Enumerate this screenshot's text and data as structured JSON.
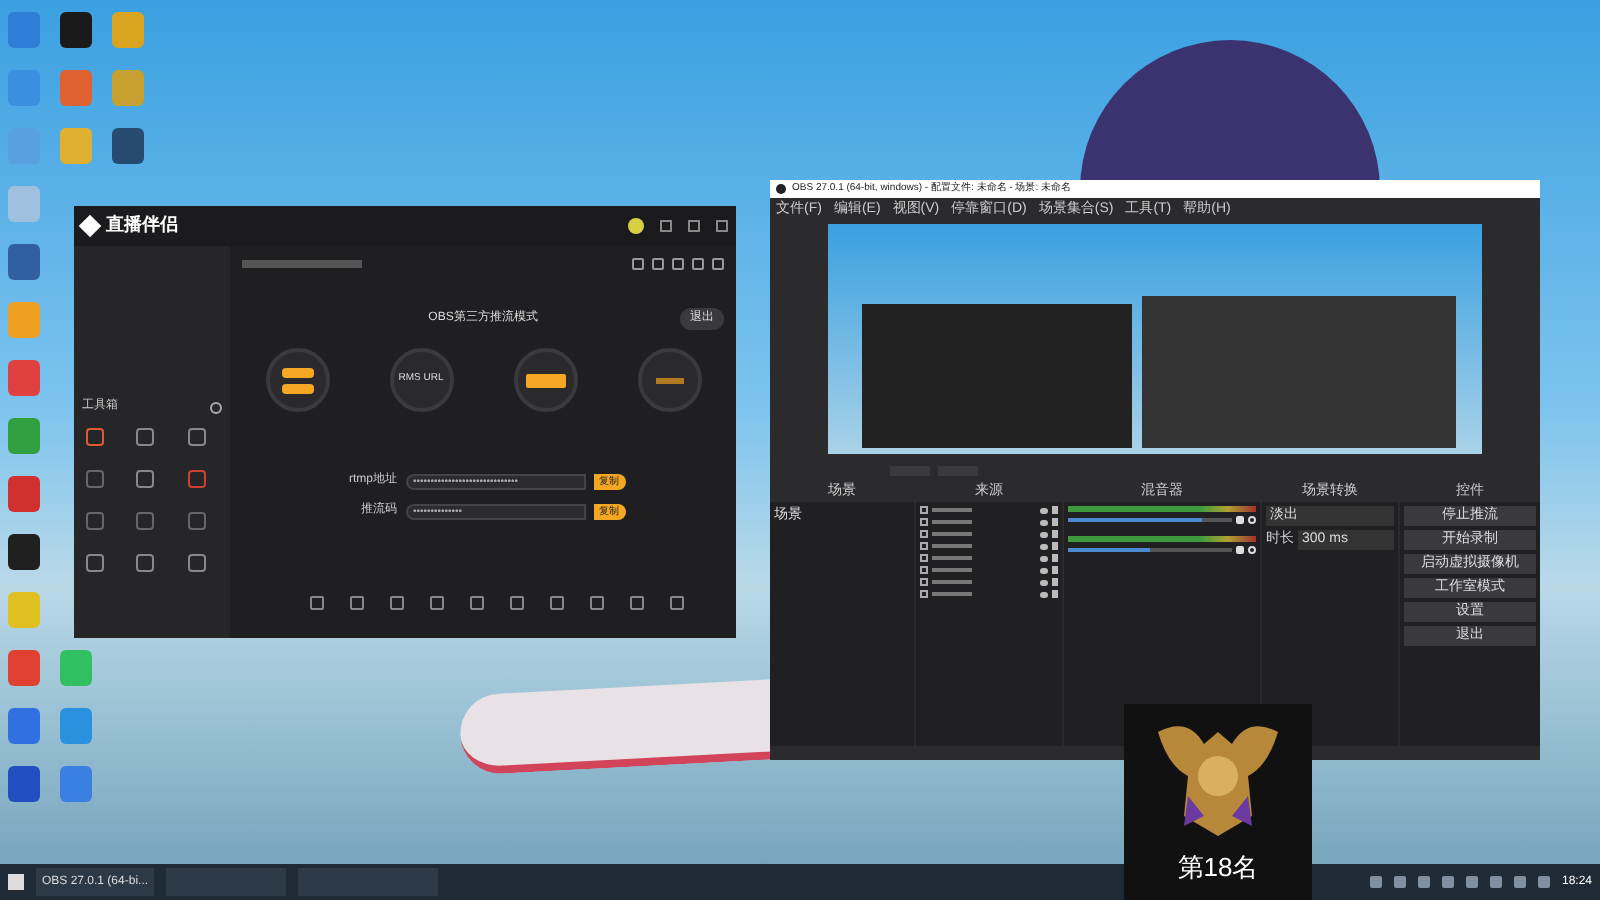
{
  "live_app": {
    "logo": "直播伴侣",
    "toolbox_title": "工具箱",
    "mode_title": "OBS第三方推流模式",
    "exit_button": "退出",
    "steps": [
      {
        "kind": "two_buttons"
      },
      {
        "kind": "text",
        "text": "RMS URL"
      },
      {
        "kind": "one_button"
      },
      {
        "kind": "ring"
      }
    ],
    "fields": [
      {
        "label": "rtmp地址",
        "value": "••••••••••••••••••••••••••••••",
        "button": "复制"
      },
      {
        "label": "推流码",
        "value": "••••••••••••••",
        "button": "复制"
      }
    ]
  },
  "obs": {
    "title": "OBS 27.0.1 (64-bit, windows) - 配置文件: 未命名 - 场景: 未命名",
    "menu": [
      "文件(F)",
      "编辑(E)",
      "视图(V)",
      "停靠窗口(D)",
      "场景集合(S)",
      "工具(T)",
      "帮助(H)"
    ],
    "docks": [
      "场景",
      "来源",
      "混音器",
      "场景转换",
      "控件"
    ],
    "scenes": [
      "场景"
    ],
    "mixer": [
      {
        "level": 0.82
      },
      {
        "level": 0.5
      }
    ],
    "transition": {
      "value": "淡出",
      "duration_label": "时长",
      "duration": "300 ms"
    },
    "controls": [
      "停止推流",
      "开始录制",
      "启动虚拟摄像机",
      "工作室模式",
      "设置",
      "退出"
    ]
  },
  "rank_overlay": {
    "text": "第18名"
  },
  "taskbar": {
    "tasks": [
      "OBS 27.0.1 (64-bi..."
    ],
    "clock": "18:24"
  }
}
